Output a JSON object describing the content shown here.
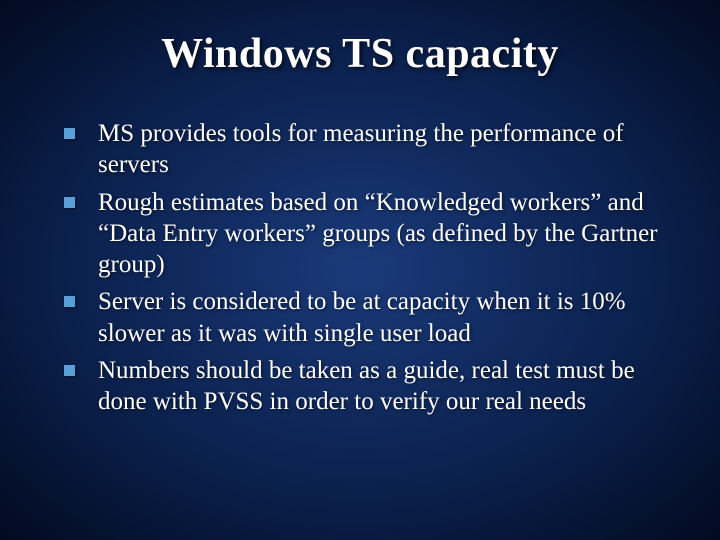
{
  "slide": {
    "title": "Windows TS capacity",
    "bullets": [
      "MS provides tools for measuring the performance of servers",
      "Rough estimates based on “Knowledged workers” and “Data Entry workers” groups (as defined by the Gartner group)",
      "Server is considered to be at capacity when it is 10% slower as it was with single user load",
      "Numbers should be taken as a guide, real test must be done with PVSS in order to verify our real needs"
    ]
  }
}
